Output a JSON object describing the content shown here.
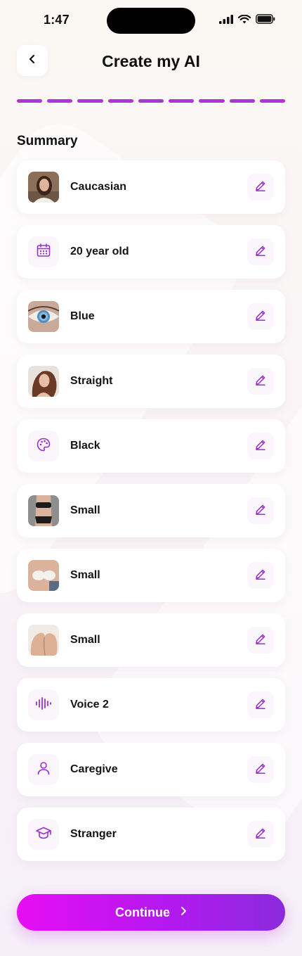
{
  "status_bar": {
    "time": "1:47"
  },
  "header": {
    "title": "Create my AI",
    "back_icon": "chevron-left-icon"
  },
  "progress": {
    "total_steps": 9,
    "completed_steps": 9,
    "color": "#b431e0"
  },
  "summary": {
    "title": "Summary",
    "items": [
      {
        "label": "Caucasian",
        "visual": "photo-portrait",
        "edit_icon": "pencil-icon"
      },
      {
        "label": "20 year old",
        "visual": "calendar-icon",
        "edit_icon": "pencil-icon"
      },
      {
        "label": "Blue",
        "visual": "photo-eye",
        "edit_icon": "pencil-icon"
      },
      {
        "label": "Straight",
        "visual": "photo-hair",
        "edit_icon": "pencil-icon"
      },
      {
        "label": "Black",
        "visual": "palette-icon",
        "edit_icon": "pencil-icon"
      },
      {
        "label": "Small",
        "visual": "photo-body",
        "edit_icon": "pencil-icon"
      },
      {
        "label": "Small",
        "visual": "photo-chest",
        "edit_icon": "pencil-icon"
      },
      {
        "label": "Small",
        "visual": "photo-back",
        "edit_icon": "pencil-icon"
      },
      {
        "label": "Voice 2",
        "visual": "waveform-icon",
        "edit_icon": "pencil-icon"
      },
      {
        "label": "Caregive",
        "visual": "person-icon",
        "edit_icon": "pencil-icon"
      },
      {
        "label": "Stranger",
        "visual": "graduation-cap-icon",
        "edit_icon": "pencil-icon"
      }
    ]
  },
  "continue_button": {
    "label": "Continue",
    "icon": "chevron-right-icon"
  },
  "colors": {
    "accent": "#9b2fd6",
    "button_start": "#e60ef2",
    "button_end": "#8a2bdc"
  }
}
